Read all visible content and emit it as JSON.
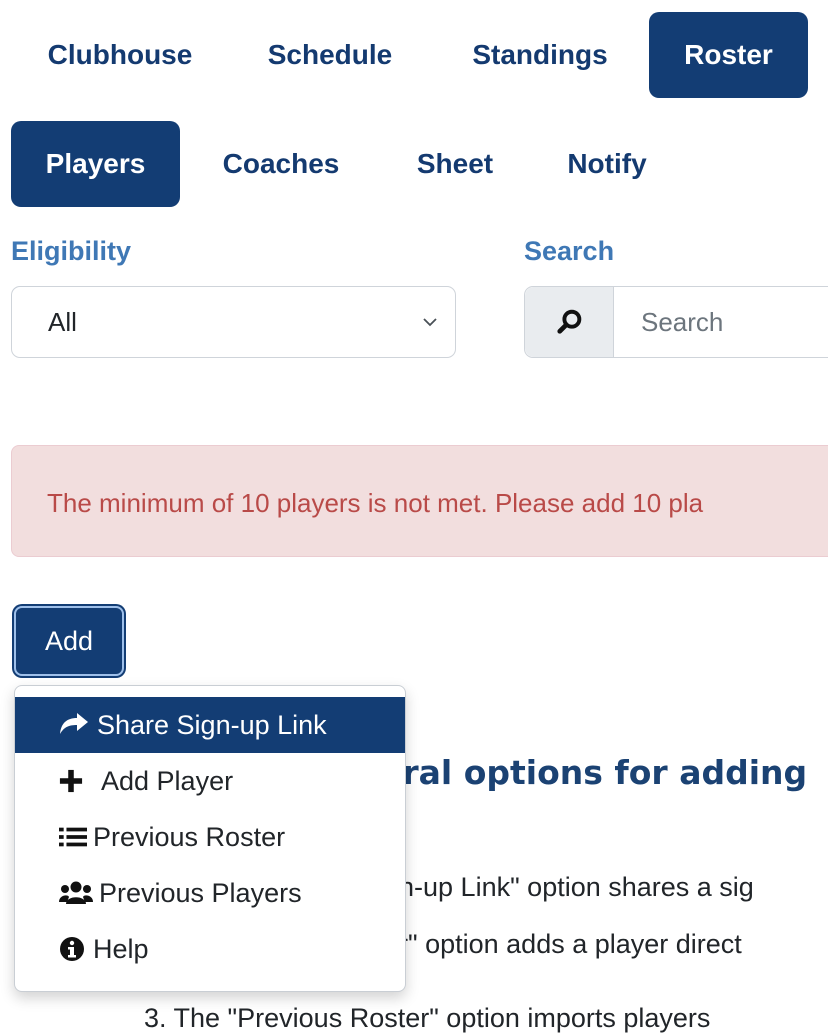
{
  "nav": {
    "tabs": [
      {
        "label": "Clubhouse",
        "active": false
      },
      {
        "label": "Schedule",
        "active": false
      },
      {
        "label": "Standings",
        "active": false
      },
      {
        "label": "Roster",
        "active": true
      }
    ]
  },
  "subnav": {
    "tabs": [
      {
        "label": "Players",
        "active": true
      },
      {
        "label": "Coaches",
        "active": false
      },
      {
        "label": "Sheet",
        "active": false
      },
      {
        "label": "Notify",
        "active": false
      }
    ]
  },
  "filters": {
    "eligibility_label": "Eligibility",
    "eligibility_value": "All",
    "search_label": "Search",
    "search_placeholder": "Search"
  },
  "alert": {
    "text": "The minimum of 10 players is not met. Please add 10 pla"
  },
  "add_button": {
    "label": "Add"
  },
  "add_menu": {
    "items": [
      {
        "label": "Share Sign-up Link",
        "icon": "share-icon",
        "active": true
      },
      {
        "label": "Add Player",
        "icon": "plus-icon",
        "active": false
      },
      {
        "label": "Previous Roster",
        "icon": "list-icon",
        "active": false
      },
      {
        "label": "Previous Players",
        "icon": "users-icon",
        "active": false
      },
      {
        "label": "Help",
        "icon": "info-icon",
        "active": false
      }
    ]
  },
  "content": {
    "heading": "eral options for adding",
    "lines": [
      "gn-up Link\" option shares a sig",
      "er\" option adds a player direct",
      "3. The \"Previous Roster\" option imports players"
    ]
  },
  "colors": {
    "primary": "#133d74",
    "label_blue": "#3f78b5",
    "alert_bg": "#f2dede",
    "alert_text": "#b94a48"
  }
}
